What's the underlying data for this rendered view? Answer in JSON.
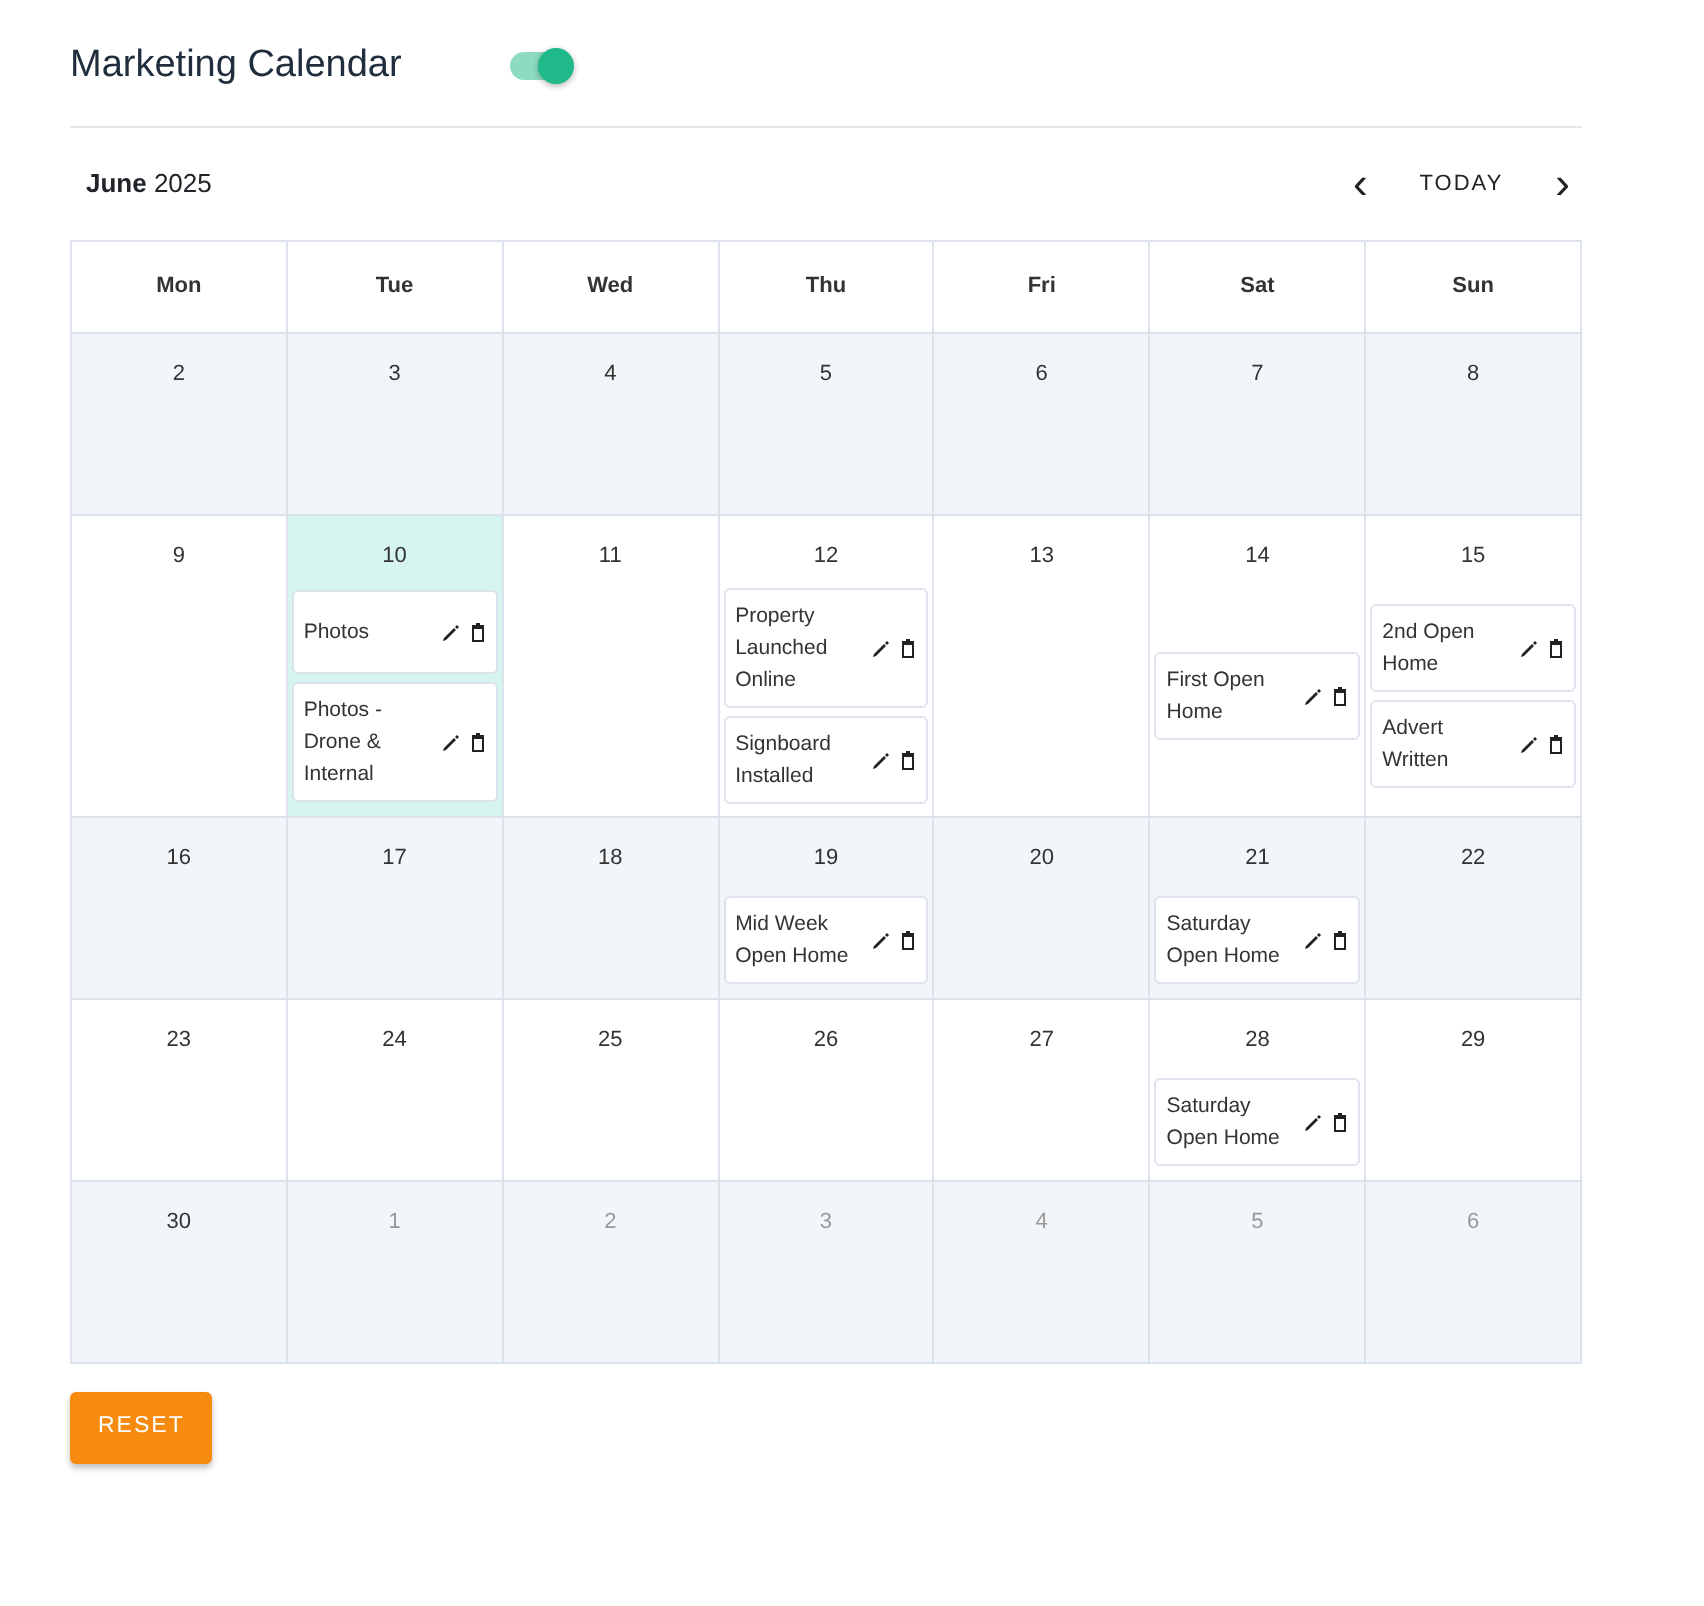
{
  "header": {
    "title": "Marketing Calendar",
    "toggle": {
      "on": true
    }
  },
  "toolbar": {
    "month_label": "**June** 2025",
    "prev": "‹",
    "today": "TODAY",
    "next": "›"
  },
  "calendar": {
    "weekdays": [
      "Mon",
      "Tue",
      "Wed",
      "Thu",
      "Fri",
      "Sat",
      "Sun"
    ],
    "weeks": [
      [
        {
          "day": "2",
          "in_month": true,
          "today": false
        },
        {
          "day": "3",
          "in_month": true,
          "today": false
        },
        {
          "day": "4",
          "in_month": true,
          "today": false
        },
        {
          "day": "5",
          "in_month": true,
          "today": false
        },
        {
          "day": "6",
          "in_month": true,
          "today": false
        },
        {
          "day": "7",
          "in_month": true,
          "today": false
        },
        {
          "day": "8",
          "in_month": true,
          "today": false
        }
      ],
      [
        {
          "day": "9",
          "in_month": true,
          "today": false
        },
        {
          "day": "10",
          "in_month": true,
          "today": true,
          "events": [
            "Photos",
            "Photos - Drone & Internal"
          ]
        },
        {
          "day": "11",
          "in_month": true,
          "today": false
        },
        {
          "day": "12",
          "in_month": true,
          "today": false,
          "events": [
            "Property Launched Online",
            "Signboard Installed"
          ]
        },
        {
          "day": "13",
          "in_month": true,
          "today": false
        },
        {
          "day": "14",
          "in_month": true,
          "today": false,
          "events": [
            "First Open Home"
          ]
        },
        {
          "day": "15",
          "in_month": true,
          "today": false,
          "events": [
            "2nd Open Home",
            "Advert Written"
          ]
        }
      ],
      [
        {
          "day": "16",
          "in_month": true,
          "today": false
        },
        {
          "day": "17",
          "in_month": true,
          "today": false
        },
        {
          "day": "18",
          "in_month": true,
          "today": false
        },
        {
          "day": "19",
          "in_month": true,
          "today": false,
          "events": [
            "Mid Week Open Home"
          ]
        },
        {
          "day": "20",
          "in_month": true,
          "today": false
        },
        {
          "day": "21",
          "in_month": true,
          "today": false,
          "events": [
            "Saturday Open Home"
          ]
        },
        {
          "day": "22",
          "in_month": true,
          "today": false
        }
      ],
      [
        {
          "day": "23",
          "in_month": true,
          "today": false
        },
        {
          "day": "24",
          "in_month": true,
          "today": false
        },
        {
          "day": "25",
          "in_month": true,
          "today": false
        },
        {
          "day": "26",
          "in_month": true,
          "today": false
        },
        {
          "day": "27",
          "in_month": true,
          "today": false
        },
        {
          "day": "28",
          "in_month": true,
          "today": false,
          "events": [
            "Saturday Open Home"
          ]
        },
        {
          "day": "29",
          "in_month": true,
          "today": false
        }
      ],
      [
        {
          "day": "30",
          "in_month": true,
          "today": false
        },
        {
          "day": "1",
          "in_month": false,
          "today": false
        },
        {
          "day": "2",
          "in_month": false,
          "today": false
        },
        {
          "day": "3",
          "in_month": false,
          "today": false
        },
        {
          "day": "4",
          "in_month": false,
          "today": false
        },
        {
          "day": "5",
          "in_month": false,
          "today": false
        },
        {
          "day": "6",
          "in_month": false,
          "today": false
        }
      ]
    ]
  },
  "reset_button": "RESET"
}
